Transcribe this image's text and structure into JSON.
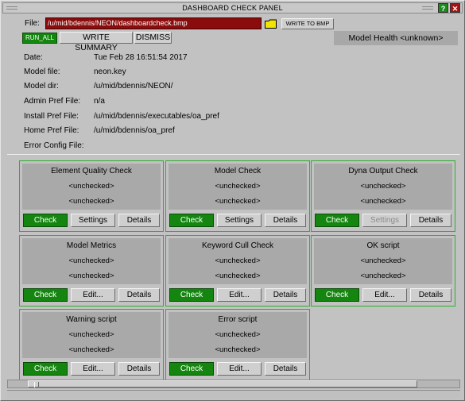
{
  "window": {
    "title": "DASHBOARD CHECK PANEL",
    "help_btn": "?",
    "close_btn": "✕"
  },
  "toolbar": {
    "file_label": "File:",
    "file_value": "/u/mid/bdennis/NEON/dashboardcheck.bmp",
    "write_bmp": "WRITE TO BMP",
    "run_all": "RUN_ALL",
    "write_summary": "WRITE SUMMARY",
    "dismiss": "DISMISS",
    "model_health": "Model Health <unknown>"
  },
  "info": [
    {
      "label": "Date:",
      "value": "Tue Feb 28 16:51:54 2017"
    },
    {
      "label": "Model file:",
      "value": "neon.key"
    },
    {
      "label": "Model dir:",
      "value": "/u/mid/bdennis/NEON/"
    },
    {
      "label": "Admin Pref File:",
      "value": "n/a"
    },
    {
      "label": "Install Pref File:",
      "value": "/u/mid/bdennis/executables/oa_pref"
    },
    {
      "label": "Home Pref File:",
      "value": "/u/mid/bdennis/oa_pref"
    },
    {
      "label": "Error Config File:",
      "value": ""
    }
  ],
  "cards": [
    {
      "title": "Element Quality Check",
      "status1": "<unchecked>",
      "status2": "<unchecked>",
      "check": "Check",
      "mid": "Settings",
      "details": "Details"
    },
    {
      "title": "Model Check",
      "status1": "<unchecked>",
      "status2": "<unchecked>",
      "check": "Check",
      "mid": "Settings",
      "details": "Details"
    },
    {
      "title": "Dyna Output Check",
      "status1": "<unchecked>",
      "status2": "<unchecked>",
      "check": "Check",
      "mid": "Settings",
      "details": "Details"
    },
    {
      "title": "Model Metrics",
      "status1": "<unchecked>",
      "status2": "<unchecked>",
      "check": "Check",
      "mid": "Edit...",
      "details": "Details"
    },
    {
      "title": "Keyword Cull Check",
      "status1": "<unchecked>",
      "status2": "<unchecked>",
      "check": "Check",
      "mid": "Edit...",
      "details": "Details"
    },
    {
      "title": "OK script",
      "status1": "<unchecked>",
      "status2": "<unchecked>",
      "check": "Check",
      "mid": "Edit...",
      "details": "Details"
    },
    {
      "title": "Warning script",
      "status1": "<unchecked>",
      "status2": "<unchecked>",
      "check": "Check",
      "mid": "Edit...",
      "details": "Details"
    },
    {
      "title": "Error script",
      "status1": "<unchecked>",
      "status2": "<unchecked>",
      "check": "Check",
      "mid": "Edit...",
      "details": "Details"
    }
  ],
  "colors": {
    "accent_green": "#14860f",
    "file_field_red": "#8b0c0c",
    "card_border": "#2fae2f"
  }
}
